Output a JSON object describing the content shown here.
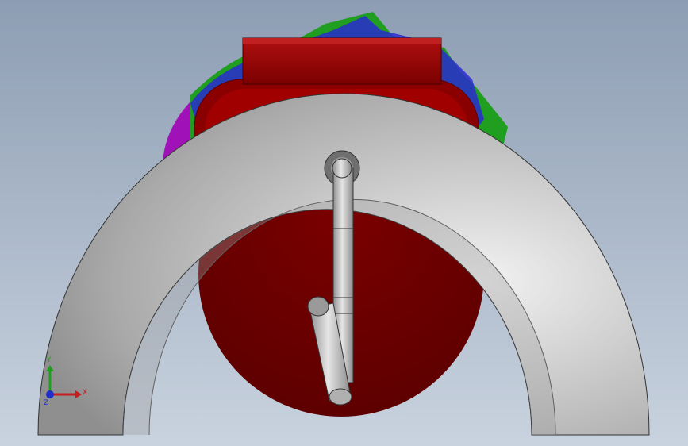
{
  "viewport": {
    "background_top": "#8d9db3",
    "background_bottom": "#c9d3df"
  },
  "model": {
    "parts": [
      {
        "name": "outer-torus-body",
        "color": "#b5b5b5"
      },
      {
        "name": "red-housing",
        "color": "#8a0000"
      },
      {
        "name": "green-blades",
        "color": "#1f9e1f"
      },
      {
        "name": "blue-blades",
        "color": "#2a2ad0"
      },
      {
        "name": "purple-blades",
        "color": "#a012b8"
      },
      {
        "name": "inlet-pipe",
        "color": "#bfbfbf"
      }
    ]
  },
  "triad": {
    "x_label": "X",
    "y_label": "Y",
    "z_label": "Z",
    "x_color": "#c81e1e",
    "y_color": "#1e9e1e",
    "z_color": "#1e2ec8"
  }
}
